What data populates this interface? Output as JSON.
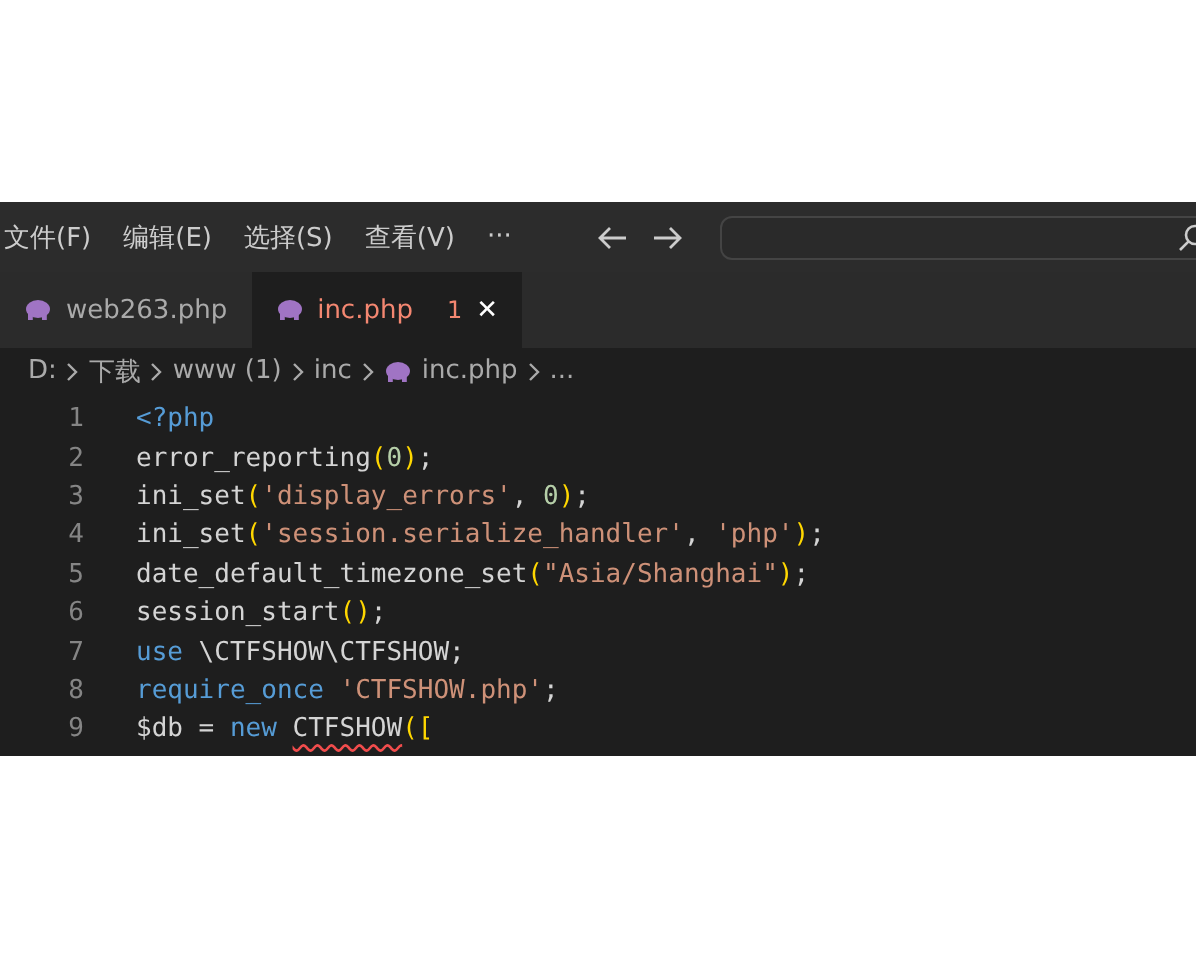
{
  "menu": [
    {
      "label": "文件(F)"
    },
    {
      "label": "编辑(E)"
    },
    {
      "label": "选择(S)"
    },
    {
      "label": "查看(V)"
    },
    {
      "label": "···"
    }
  ],
  "tabs": [
    {
      "label": "web263.php",
      "selected": false,
      "has_errors": false
    },
    {
      "label": "inc.php",
      "selected": true,
      "has_errors": true,
      "problem_count": "1",
      "close": "✕"
    }
  ],
  "breadcrumb": [
    {
      "label": "D:",
      "kind": "folder"
    },
    {
      "label": "下载",
      "kind": "folder"
    },
    {
      "label": "www (1)",
      "kind": "folder"
    },
    {
      "label": "inc",
      "kind": "folder"
    },
    {
      "label": "inc.php",
      "kind": "file"
    },
    {
      "label": "...",
      "kind": "more"
    }
  ],
  "code_lines": [
    {
      "number": "1",
      "tokens": [
        {
          "text": "<?php",
          "kind": "keyword"
        }
      ]
    },
    {
      "number": "2",
      "tokens": [
        {
          "text": "error_reporting",
          "kind": "plain"
        },
        {
          "text": "(",
          "kind": "bracket"
        },
        {
          "text": "0",
          "kind": "number"
        },
        {
          "text": ")",
          "kind": "bracket"
        },
        {
          "text": ";",
          "kind": "plain"
        }
      ]
    },
    {
      "number": "3",
      "tokens": [
        {
          "text": "ini_set",
          "kind": "plain"
        },
        {
          "text": "(",
          "kind": "bracket"
        },
        {
          "text": "'display_errors'",
          "kind": "string"
        },
        {
          "text": ", ",
          "kind": "plain"
        },
        {
          "text": "0",
          "kind": "number"
        },
        {
          "text": ")",
          "kind": "bracket"
        },
        {
          "text": ";",
          "kind": "plain"
        }
      ]
    },
    {
      "number": "4",
      "tokens": [
        {
          "text": "ini_set",
          "kind": "plain"
        },
        {
          "text": "(",
          "kind": "bracket"
        },
        {
          "text": "'session.serialize_handler'",
          "kind": "string"
        },
        {
          "text": ", ",
          "kind": "plain"
        },
        {
          "text": "'php'",
          "kind": "string"
        },
        {
          "text": ")",
          "kind": "bracket"
        },
        {
          "text": ";",
          "kind": "plain"
        }
      ]
    },
    {
      "number": "5",
      "tokens": [
        {
          "text": "date_default_timezone_set",
          "kind": "plain"
        },
        {
          "text": "(",
          "kind": "bracket"
        },
        {
          "text": "\"Asia/Shanghai\"",
          "kind": "string"
        },
        {
          "text": ")",
          "kind": "bracket"
        },
        {
          "text": ";",
          "kind": "plain"
        }
      ]
    },
    {
      "number": "6",
      "tokens": [
        {
          "text": "session_start",
          "kind": "plain"
        },
        {
          "text": "()",
          "kind": "bracket"
        },
        {
          "text": ";",
          "kind": "plain"
        }
      ]
    },
    {
      "number": "7",
      "tokens": [
        {
          "text": "use",
          "kind": "keyword"
        },
        {
          "text": " \\CTFSHOW\\CTFSHOW;",
          "kind": "plain"
        }
      ]
    },
    {
      "number": "8",
      "tokens": [
        {
          "text": "require_once",
          "kind": "keyword"
        },
        {
          "text": " 'CTFSHOW.php'",
          "kind": "string"
        },
        {
          "text": ";",
          "kind": "plain"
        }
      ]
    },
    {
      "number": "9",
      "tokens": [
        {
          "text": "$db = ",
          "kind": "plain"
        },
        {
          "text": "new ",
          "kind": "keyword"
        },
        {
          "text": "CTFSHOW",
          "kind": "error"
        },
        {
          "text": "([",
          "kind": "bracket"
        }
      ]
    }
  ]
}
